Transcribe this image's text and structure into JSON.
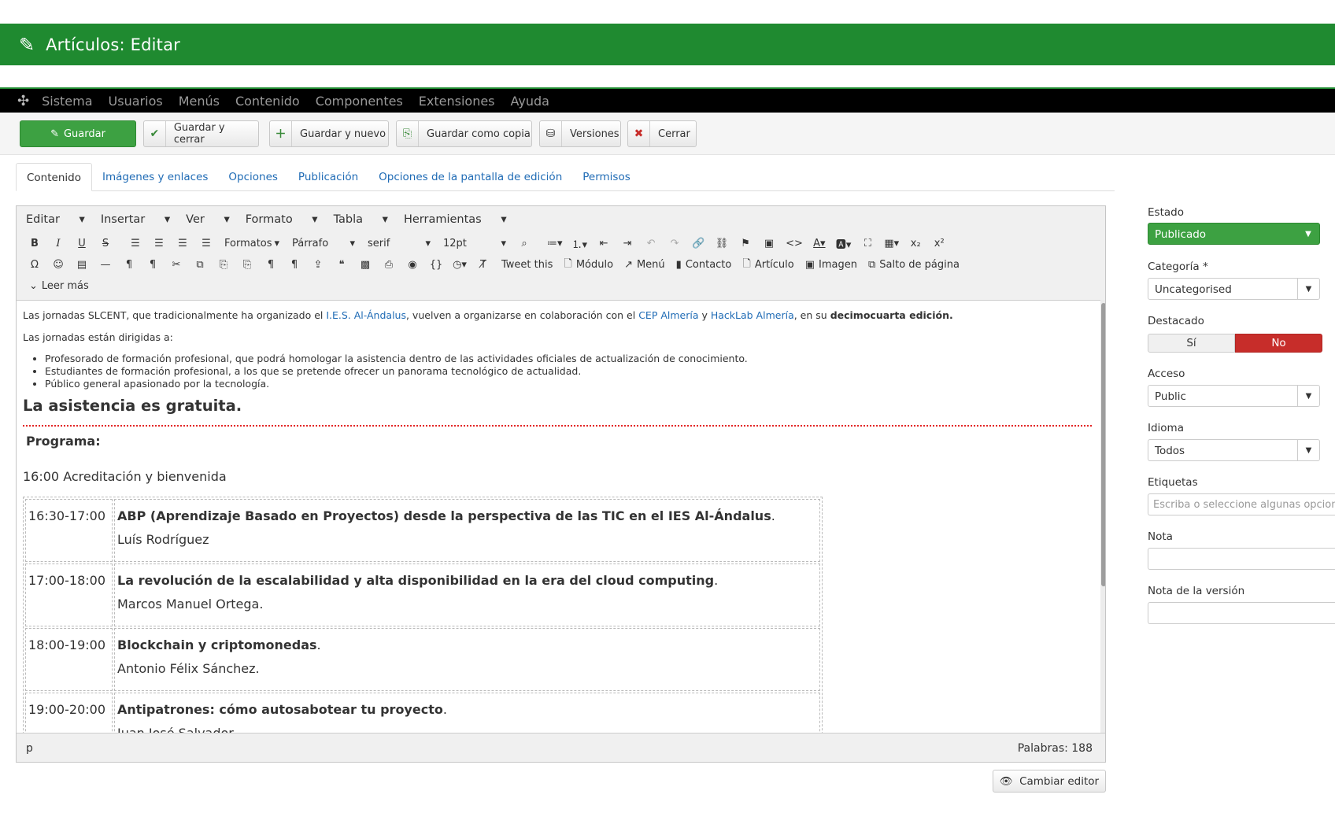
{
  "header": {
    "title": "Artículos: Editar",
    "icon": "pencil-icon"
  },
  "menu": {
    "items": [
      "Sistema",
      "Usuarios",
      "Menús",
      "Contenido",
      "Componentes",
      "Extensiones",
      "Ayuda"
    ]
  },
  "toolbar": {
    "save": "Guardar",
    "save_close": "Guardar y cerrar",
    "save_new": "Guardar y nuevo",
    "save_copy": "Guardar como copia",
    "versions": "Versiones",
    "close": "Cerrar"
  },
  "tabs": [
    "Contenido",
    "Imágenes y enlaces",
    "Opciones",
    "Publicación",
    "Opciones de la pantalla de edición",
    "Permisos"
  ],
  "editor": {
    "menu": [
      "Editar",
      "Insertar",
      "Ver",
      "Formato",
      "Tabla",
      "Herramientas"
    ],
    "formats": "Formatos",
    "block": "Párrafo",
    "font": "serif",
    "size": "12pt",
    "tweet": "Tweet this",
    "module": "Módulo",
    "menu_btn": "Menú",
    "contact": "Contacto",
    "article": "Artículo",
    "image": "Imagen",
    "pagebreak": "Salto de página",
    "readmore": "Leer más",
    "path": "p",
    "word_count": "Palabras: 188"
  },
  "content": {
    "p1_a": "Las jornadas SLCENT, que tradicionalmente ha organizado el ",
    "p1_link1": "I.E.S. Al-Ándalus",
    "p1_b": ", vuelven a organizarse en colaboración con el ",
    "p1_link2": "CEP Almería",
    "p1_c": " y ",
    "p1_link3": "HackLab Almería",
    "p1_d": ", en su ",
    "p1_bold": "decimocuarta edición.",
    "p2": "Las jornadas están dirigidas a:",
    "list": [
      "Profesorado de formación profesional, que podrá homologar la asistencia dentro de las actividades oficiales de actualización de conocimiento.",
      "Estudiantes de formación profesional, a los que se pretende ofrecer un panorama tecnológico de actualidad.",
      "Público general apasionado por la tecnología."
    ],
    "heading": "La asistencia es gratuita.",
    "programa": "Programa:",
    "acreditacion": "16:00 Acreditación y bienvenida",
    "schedule": [
      {
        "time": "16:30-17:00",
        "talk": "ABP (Aprendizaje Basado en Proyectos) desde la perspectiva de las TIC en el IES Al-Ándalus",
        "speaker": "Luís Rodríguez"
      },
      {
        "time": "17:00-18:00",
        "talk": "La revolución de la escalabilidad y alta disponibilidad en la era del cloud computing",
        "speaker": "Marcos Manuel Ortega."
      },
      {
        "time": "18:00-19:00",
        "talk": "Blockchain y criptomonedas",
        "speaker": "Antonio Félix Sánchez."
      },
      {
        "time": "19:00-20:00",
        "talk": "Antipatrones: cómo autosabotear tu proyecto",
        "speaker": "Juan José Salvador"
      }
    ],
    "dot": "."
  },
  "change_editor": "Cambiar editor",
  "sidebar": {
    "estado_label": "Estado",
    "estado_value": "Publicado",
    "categoria_label": "Categoría *",
    "categoria_value": "Uncategorised",
    "destacado_label": "Destacado",
    "destacado_si": "Sí",
    "destacado_no": "No",
    "acceso_label": "Acceso",
    "acceso_value": "Public",
    "idioma_label": "Idioma",
    "idioma_value": "Todos",
    "etiquetas_label": "Etiquetas",
    "etiquetas_placeholder": "Escriba o seleccione algunas opciones",
    "nota_label": "Nota",
    "nota_version_label": "Nota de la versión"
  },
  "colors": {
    "header_green": "#1f8a30",
    "save_green": "#3da142",
    "no_red": "#c72d2a",
    "link_blue": "#1f6bb5"
  }
}
